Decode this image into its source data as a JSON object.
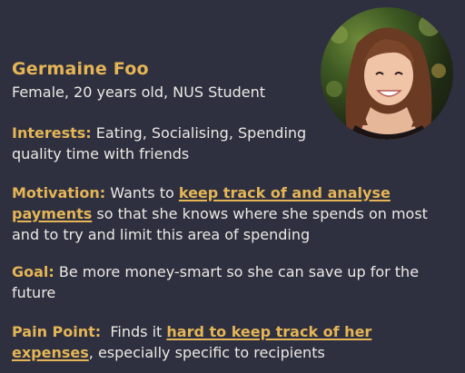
{
  "profile": {
    "name": "Germaine Foo",
    "subtitle": "Female, 20 years old, NUS Student",
    "photo": "portrait-photo"
  },
  "interests": {
    "label": "Interests:",
    "text": " Eating, Socialising, Spending quality time with friends"
  },
  "motivation": {
    "label": "Motivation:",
    "pre": " Wants to ",
    "highlight": "keep track of and analyse payments",
    "post": " so that she knows where she spends on most and to try and limit this area of spending"
  },
  "goal": {
    "label": "Goal:",
    "text": " Be more money-smart so she can save up for the future"
  },
  "pain_point": {
    "label": "Pain Point:",
    "pre": "  Finds it ",
    "highlight": "hard to keep track of her expenses",
    "post": ", especially specific to recipients"
  },
  "colors": {
    "background": "#2e3040",
    "accent": "#e5b556",
    "text": "#ece9e3"
  }
}
